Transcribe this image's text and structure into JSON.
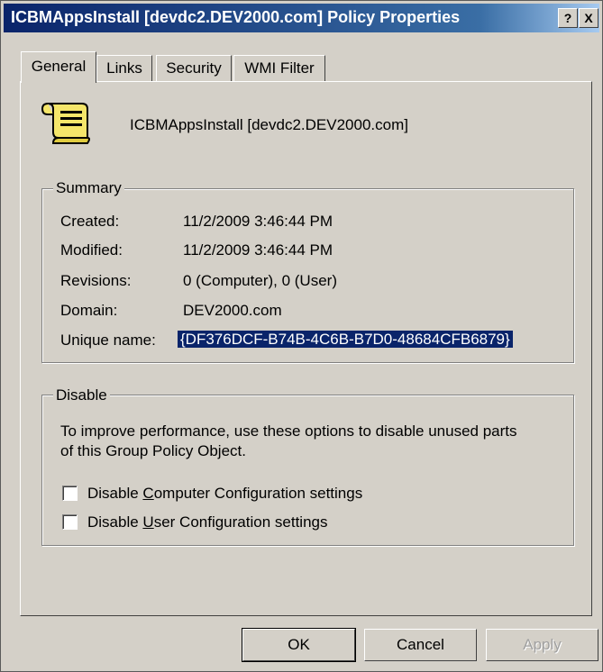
{
  "window": {
    "title": "ICBMAppsInstall [devdc2.DEV2000.com] Policy Properties",
    "help_button": "?",
    "close_button": "X"
  },
  "tabs": [
    {
      "label": "General"
    },
    {
      "label": "Links"
    },
    {
      "label": "Security"
    },
    {
      "label": "WMI Filter"
    }
  ],
  "general": {
    "gpo_name": "ICBMAppsInstall [devdc2.DEV2000.com]"
  },
  "summary": {
    "legend": "Summary",
    "rows": [
      {
        "label": "Created:",
        "value": "11/2/2009 3:46:44 PM"
      },
      {
        "label": "Modified:",
        "value": "11/2/2009 3:46:44 PM"
      },
      {
        "label": "Revisions:",
        "value": "0 (Computer), 0 (User)"
      },
      {
        "label": "Domain:",
        "value": "DEV2000.com"
      },
      {
        "label": "Unique name:",
        "value": "{DF376DCF-B74B-4C6B-B7D0-48684CFB6879}"
      }
    ]
  },
  "disable": {
    "legend": "Disable",
    "description": "To improve performance, use these options to disable unused parts of this Group Policy Object.",
    "options": [
      {
        "prefix": "Disable ",
        "mnemonic": "C",
        "rest": "omputer Configuration settings",
        "checked": false
      },
      {
        "prefix": "Disable ",
        "mnemonic": "U",
        "rest": "ser Configuration settings",
        "checked": false
      }
    ]
  },
  "buttons": {
    "ok": "OK",
    "cancel": "Cancel",
    "apply": "Apply"
  },
  "colors": {
    "dialog_bg": "#d4d0c8",
    "titlebar": "#0a246a",
    "selection": "#0a246a"
  }
}
